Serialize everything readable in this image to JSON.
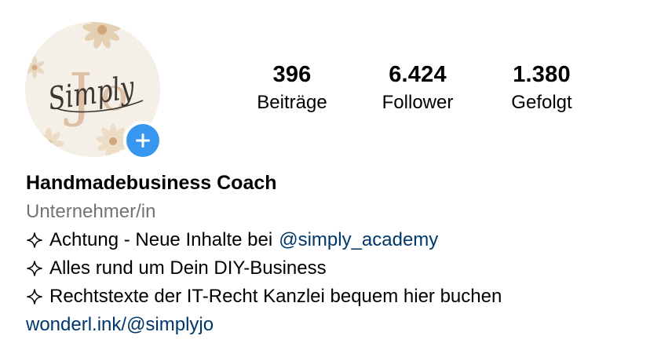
{
  "profile": {
    "avatar": {
      "logo_text": "Simply",
      "logo_monogram": "Jo",
      "background": "#f4efe7",
      "accent": "#d9b99a"
    },
    "add_badge": {
      "icon": "plus-icon",
      "color": "#3797f0"
    }
  },
  "stats": {
    "posts": {
      "value": "396",
      "label": "Beiträge"
    },
    "followers": {
      "value": "6.424",
      "label": "Follower"
    },
    "following": {
      "value": "1.380",
      "label": "Gefolgt"
    }
  },
  "bio": {
    "name": "Handmadebusiness Coach",
    "category": "Unternehmer/in",
    "lines": [
      {
        "icon": "sparkle-icon",
        "text": "Achtung - Neue Inhalte bei",
        "mention": "@simply_academy"
      },
      {
        "icon": "sparkle-icon",
        "text": "Alles rund um Dein DIY-Business"
      },
      {
        "icon": "sparkle-icon",
        "text": "Rechtstexte der IT-Recht Kanzlei bequem hier buchen"
      }
    ],
    "link": "wonderl.ink/@simplyjo"
  },
  "colors": {
    "link": "#00376b",
    "category": "#737373",
    "badge": "#3797f0"
  }
}
